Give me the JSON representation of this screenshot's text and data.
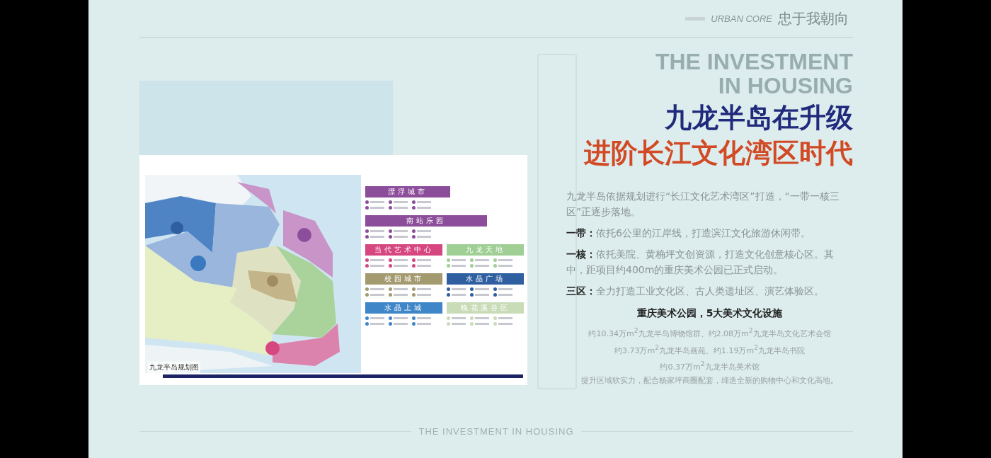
{
  "header": {
    "tagline": "URBAN CORE",
    "slogan": "忠于我朝向"
  },
  "background_text": [
    "THE INVESTMENT",
    "IN HOUSING"
  ],
  "map_card": {
    "caption": "九龙半岛规划图",
    "legend": [
      {
        "title": "漂浮城市",
        "color": "#8c4e9a"
      },
      {
        "title": "南站乐园",
        "color": "#8c4e9a"
      },
      {
        "title": "当代艺术中心",
        "color": "#d6467f"
      },
      {
        "title": "九龙天地",
        "color": "#9fcf95"
      },
      {
        "title": "校园城市",
        "color": "#a49a70"
      },
      {
        "title": "水晶广场",
        "color": "#2f5fa0"
      },
      {
        "title": "水晶上城",
        "color": "#3f86c8"
      },
      {
        "title": "晚花溪谷区",
        "color": "#c9dcb8"
      }
    ]
  },
  "headline": {
    "line_1": "九龙半岛在升级",
    "line_2": "进阶长江文化湾区时代"
  },
  "intro": "九龙半岛依据规划进行“长江文化艺术湾区”打造，“一带一核三区”正逐步落地。",
  "points": [
    {
      "label": "一带：",
      "text": "依托6公里的江岸线，打造滨江文化旅游休闲带。"
    },
    {
      "label": "一核：",
      "text": "依托美院、黄桷坪文创资源，打造文化创意核心区。其中，距项目约400m的重庆美术公园已正式启动。"
    },
    {
      "label": "三区：",
      "text": "全力打造工业文化区、古人类遗址区、演艺体验区。"
    }
  ],
  "facilities": {
    "title": "重庆美术公园，5大美术文化设施",
    "lines": [
      "约10.34万m$^{2}$九龙半岛博物馆群、约2.08万m$^{2}$九龙半岛文化艺术会馆",
      "约3.73万m$^{2}$九龙半岛画苑、约1.19万m$^{2}$九龙半岛书院",
      "约0.37万m$^{2}$九龙半岛美术馆",
      "提升区域软实力，配合杨家坪商圈配套，缔造全新的购物中心和文化高地。"
    ]
  },
  "footer": {
    "text": "THE INVESTMENT IN HOUSING"
  }
}
